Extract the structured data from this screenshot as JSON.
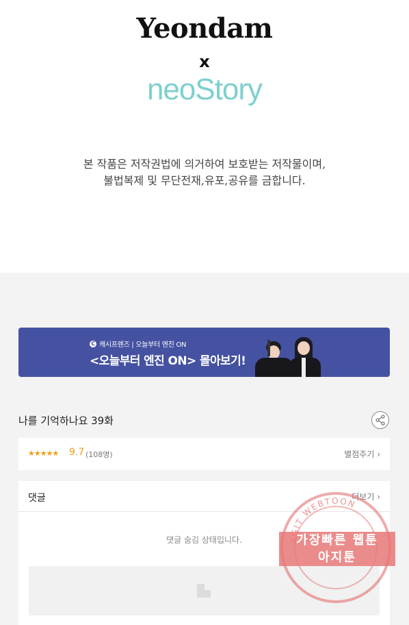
{
  "header": {
    "brand_primary": "Yeondam",
    "brand_x": "x",
    "brand_secondary": "neoStory"
  },
  "notice": {
    "line1": "본 작품은 저작권법에 의거하여 보호받는 저작물이며,",
    "line2": "불법복제 및 무단전재,유포,공유를 금합니다."
  },
  "banner": {
    "small_text": "캐시프렌즈 | 오늘부터 엔진 ON",
    "main_text": "<오늘부터 엔진 ON> 몰아보기!"
  },
  "episode": {
    "title": "나를 기억하나요 39화"
  },
  "rating": {
    "stars": "★★★★★",
    "score": "9.7",
    "count": "(108명)",
    "rate_link": "별점주기 ›"
  },
  "comments": {
    "label": "댓글",
    "more_link": "더보기 ›",
    "hidden_message": "댓글 숨김 상태입니다."
  },
  "watermark": {
    "line1": "가장빠른 웹툰",
    "line2": "아지툰",
    "ring_text": "AGIT WEBTOON"
  },
  "colors": {
    "banner_bg": "#4552a1",
    "accent_star": "#f39c12",
    "brand_teal": "#7ecfcf"
  }
}
